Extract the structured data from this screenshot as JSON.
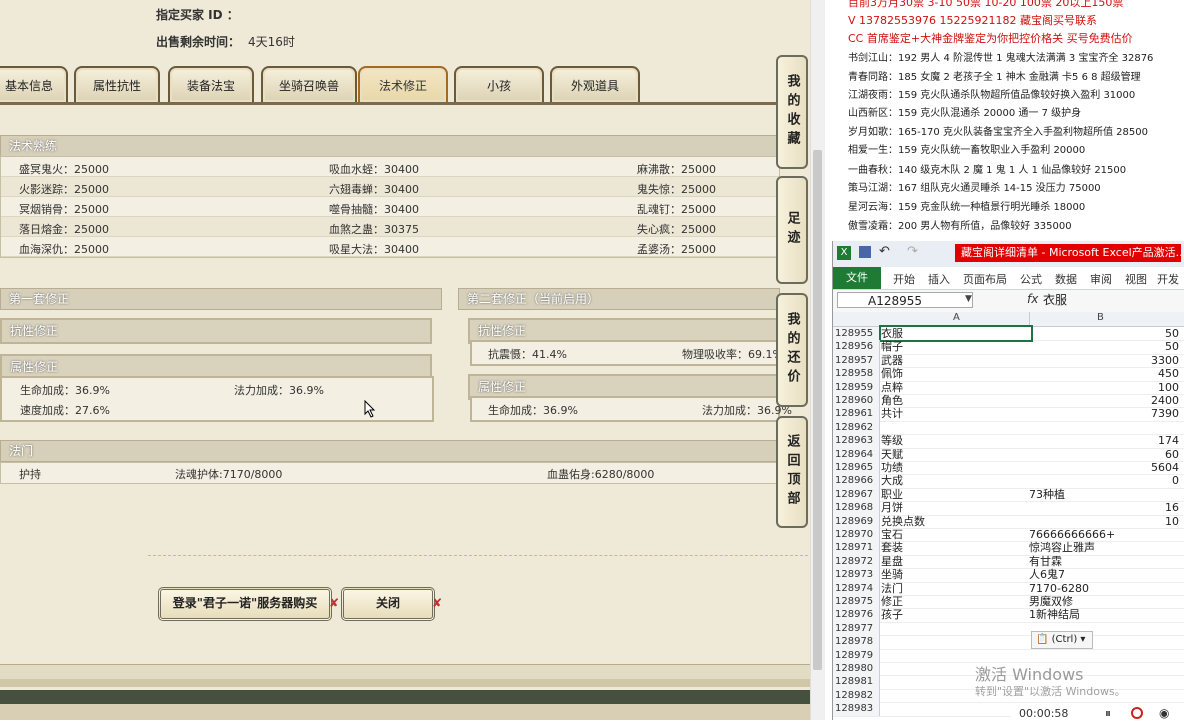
{
  "header": {
    "buyer_id_label": "指定买家 ID ：",
    "remaining_label": "出售剩余时间：",
    "remaining_value": "4天16时"
  },
  "tabs": [
    "基本信息",
    "属性抗性",
    "装备法宝",
    "坐骑召唤兽",
    "法术修正",
    "小孩",
    "外观道具"
  ],
  "active_tab": "法术修正",
  "skill_section": {
    "title": "法术熟练",
    "rows": [
      [
        "盛冥鬼火：25000",
        "吸血水蛭：30400",
        "麻沸散：25000"
      ],
      [
        "火影迷踪：25000",
        "六翅毒蝉：30400",
        "鬼失惊：25000"
      ],
      [
        "冥烟销骨：25000",
        "噬骨抽髓：30400",
        "乱魂钉：25000"
      ],
      [
        "落日熔金：25000",
        "血煞之蛊：30375",
        "失心疯：25000"
      ],
      [
        "血海深仇：25000",
        "吸星大法：30400",
        "孟婆汤：25000"
      ]
    ]
  },
  "set1": {
    "title": "第一套修正",
    "resist_title": "抗性修正",
    "attr_title": "属性修正",
    "attr_rows": [
      [
        "生命加成：36.9%",
        "法力加成：36.9%"
      ],
      [
        "速度加成：27.6%",
        ""
      ]
    ]
  },
  "set2": {
    "title": "第二套修正（当前启用）",
    "resist_title": "抗性修正",
    "resist_rows": [
      [
        "抗震慑：41.4%",
        "物理吸收率：69.1%"
      ]
    ],
    "attr_title": "属性修正",
    "attr_rows": [
      [
        "生命加成：36.9%",
        "法力加成：36.9%"
      ]
    ]
  },
  "fabao": {
    "title": "法门",
    "row": [
      "护持",
      "法魂护体:7170/8000",
      "血蛊佑身:6280/8000"
    ]
  },
  "buttons": {
    "login_buy": "登录\"君子一诺\"服务器购买",
    "close": "关闭"
  },
  "side_nav": [
    "我的收藏",
    "足迹",
    "我的还价",
    "返回顶部"
  ],
  "doc": {
    "lines": [
      {
        "text": "目前3万月30票   3-10 50票   10-20 100票   20以上150票",
        "red": true
      },
      {
        "text": "V 13782553976    15225921182   藏宝阁买号联系",
        "red": true
      },
      {
        "text": "CC 首席鉴定+大神金牌鉴定为你把控价格关  买号免费估价",
        "red": true
      },
      {
        "text": "书剑江山：192 男人 4 阶混传世 1 鬼魂大法满满 3 宝宝齐全 32876",
        "red": false
      },
      {
        "text": "青春同路：185 女魔 2 老孩子全 1 神木 金融满 卡5 6 8 超级管理",
        "red": false
      },
      {
        "text": "江湖夜雨：159 克火队通杀队物超所值品像较好换入盈利 31000",
        "red": false
      },
      {
        "text": "山西新区：159 克火队混通杀 20000 通一 7 级护身",
        "red": false
      },
      {
        "text": "岁月如歌：165-170 克火队装备宝宝齐全入手盈利物超所值 28500",
        "red": false
      },
      {
        "text": "相爱一生：159 克火队统一畜牧职业入手盈利 20000",
        "red": false
      },
      {
        "text": "一曲春秋：140 级克木队 2 魔 1 鬼 1 人 1 仙品像较好 21500",
        "red": false
      },
      {
        "text": "策马江湖：167 组队克火通灵睡杀 14-15 没压力 75000",
        "red": false
      },
      {
        "text": "星河云海：159 克金队统一种植景行明光睡杀 18000",
        "red": false
      },
      {
        "text": "傲雪凌霜：200 男人物有所值，品像较好 335000",
        "red": false
      }
    ]
  },
  "excel": {
    "title": "藏宝阁详细清单 - Microsoft Excel产品激活...",
    "ribbon_tabs": [
      "文件",
      "开始",
      "插入",
      "页面布局",
      "公式",
      "数据",
      "审阅",
      "视图",
      "开发工"
    ],
    "name_box": "A128955",
    "fx_label": "fx",
    "formula_value": "衣服",
    "col_headers": [
      "A",
      "B"
    ],
    "rows": [
      {
        "n": "128955",
        "a": "衣服",
        "b": "50"
      },
      {
        "n": "128956",
        "a": "帽子",
        "b": "50"
      },
      {
        "n": "128957",
        "a": "武器",
        "b": "3300"
      },
      {
        "n": "128958",
        "a": "佩饰",
        "b": "450"
      },
      {
        "n": "128959",
        "a": "点粹",
        "b": "100"
      },
      {
        "n": "128960",
        "a": "角色",
        "b": "2400"
      },
      {
        "n": "128961",
        "a": "共计",
        "b": "7390"
      },
      {
        "n": "128962",
        "a": "",
        "b": ""
      },
      {
        "n": "128963",
        "a": "等级",
        "b": "174"
      },
      {
        "n": "128964",
        "a": "天赋",
        "b": "60"
      },
      {
        "n": "128965",
        "a": "功绩",
        "b": "5604"
      },
      {
        "n": "128966",
        "a": "大成",
        "b": "0"
      },
      {
        "n": "128967",
        "a": "职业",
        "b": "73种植",
        "left": true
      },
      {
        "n": "128968",
        "a": "月饼",
        "b": "16"
      },
      {
        "n": "128969",
        "a": "兑换点数",
        "b": "10"
      },
      {
        "n": "128970",
        "a": "宝石",
        "b": "76666666666+",
        "left": true
      },
      {
        "n": "128971",
        "a": "套装",
        "b": "惊鸿容止雅声",
        "left": true
      },
      {
        "n": "128972",
        "a": "星盘",
        "b": "有甘霖",
        "left": true
      },
      {
        "n": "128973",
        "a": "坐骑",
        "b": "人6鬼7",
        "left": true
      },
      {
        "n": "128974",
        "a": "法门",
        "b": "7170-6280",
        "left": true
      },
      {
        "n": "128975",
        "a": "修正",
        "b": "男魔双修",
        "left": true
      },
      {
        "n": "128976",
        "a": "孩子",
        "b": "1新神结局",
        "left": true
      },
      {
        "n": "128977",
        "a": "",
        "b": ""
      },
      {
        "n": "128978",
        "a": "",
        "b": ""
      },
      {
        "n": "128979",
        "a": "",
        "b": ""
      },
      {
        "n": "128980",
        "a": "",
        "b": ""
      },
      {
        "n": "128981",
        "a": "",
        "b": ""
      },
      {
        "n": "128982",
        "a": "",
        "b": ""
      },
      {
        "n": "128983",
        "a": "",
        "b": ""
      }
    ],
    "paste_tag": "(Ctrl)",
    "watermark_title": "激活 Windows",
    "watermark_sub": "转到\"设置\"以激活 Windows。",
    "record_time": "00:00:58"
  },
  "colors": {
    "game_bg": "#efe9d8",
    "accent_red": "#d01010",
    "excel_green": "#1f7a34"
  }
}
